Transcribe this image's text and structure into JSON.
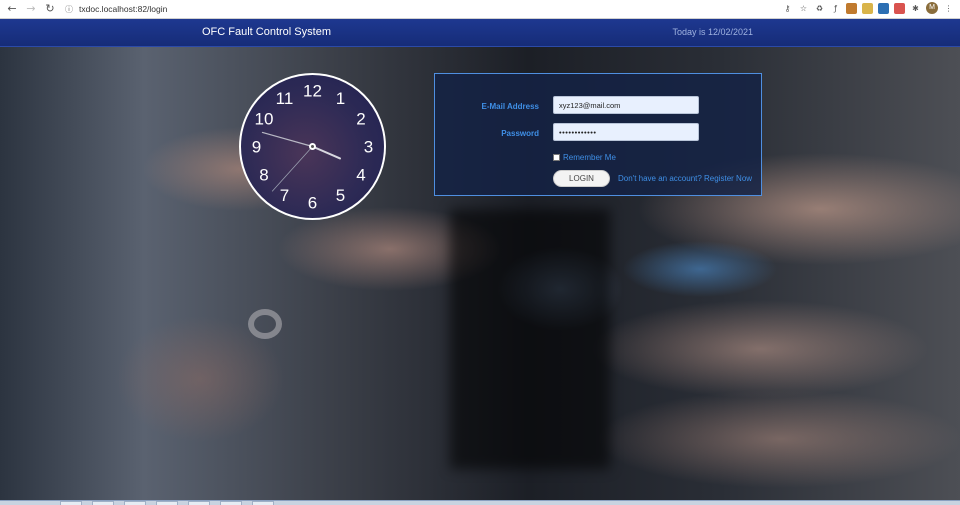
{
  "browser": {
    "url": "txdoc.localhost:82/login",
    "back_icon": "←",
    "forward_icon": "→",
    "reload_icon": "↻",
    "info_icon": "ⓘ",
    "extensions": [
      "key",
      "star",
      "recycle",
      "f?",
      "ext",
      "ext",
      "ext",
      "ext",
      "puzzle"
    ],
    "profile_initial": "M"
  },
  "header": {
    "title": "OFC Fault Control System",
    "date_text": "Today is 12/02/2021"
  },
  "clock": {
    "numbers": [
      "12",
      "1",
      "2",
      "3",
      "4",
      "5",
      "6",
      "7",
      "8",
      "9",
      "10",
      "11"
    ],
    "hour": 3,
    "minute": 47,
    "second": 37
  },
  "login": {
    "email_label": "E-Mail Address",
    "email_value": "xyz123@mail.com",
    "password_label": "Password",
    "password_value": "••••••••••••",
    "remember_label": "Remember Me",
    "button_label": "LOGIN",
    "register_text": "Don't have an account? Register Now"
  },
  "colors": {
    "header_bg": "#1e3890",
    "accent": "#3f8fe6",
    "panel_border": "#4f8fe0"
  }
}
